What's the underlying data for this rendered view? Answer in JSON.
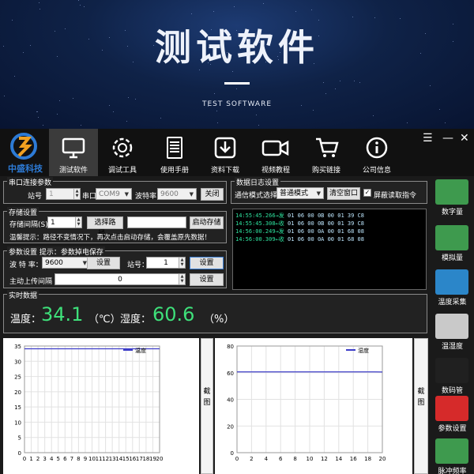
{
  "hero": {
    "title": "测试软件",
    "subtitle": "TEST SOFTWARE"
  },
  "logo": {
    "text": "中盛科技"
  },
  "toolbar": {
    "items": [
      {
        "label": "测试软件",
        "icon": "monitor-icon"
      },
      {
        "label": "调试工具",
        "icon": "gear-icon"
      },
      {
        "label": "使用手册",
        "icon": "document-icon"
      },
      {
        "label": "资料下载",
        "icon": "download-icon"
      },
      {
        "label": "视频教程",
        "icon": "video-camera-icon"
      },
      {
        "label": "购买链接",
        "icon": "shopping-cart-icon"
      },
      {
        "label": "公司信息",
        "icon": "info-icon"
      }
    ]
  },
  "window": {
    "menu": "☰",
    "minimize": "—",
    "close": "✕"
  },
  "serial": {
    "title": "串口连接参数",
    "station_label": "站号",
    "station_value": "1",
    "port_label": "串口",
    "port_value": "COM9",
    "baud_label": "波特率",
    "baud_value": "9600",
    "close_button": "关闭"
  },
  "storage": {
    "title": "存储设置",
    "interval_label": "存储间隔(S)",
    "interval_value": "1",
    "choose_path_button": "选择路径...",
    "path_value": "",
    "start_button": "启动存储",
    "hint": "温馨提示：路径不变情况下，再次点击启动存储，会覆盖原先数据！"
  },
  "params": {
    "title": "参数设置 提示：参数掉电保存",
    "baud_label": "波 特 率：",
    "baud_value": "9600",
    "baud_set": "设置",
    "station_label": "站号：",
    "station_value": "1",
    "station_set": "设置",
    "upload_label": "主动上传间隔",
    "upload_value": "0",
    "upload_set": "设置"
  },
  "logsettings": {
    "title": "数据日志设置",
    "mode_label": "通信模式选择",
    "mode_value": "普通模式",
    "clear_button": "清空窗口",
    "shield_label": "屏蔽读取指令",
    "shield_checked": true
  },
  "log": {
    "lines": [
      {
        "time": "14:55:45.266→发",
        "data": "01 06 00 0B 00 01 39 C8"
      },
      {
        "time": "14:55:45.308←收",
        "data": "01 06 00 0B 00 01 39 C8"
      },
      {
        "time": "14:56:00.249→发",
        "data": "01 06 00 0A 00 01 68 08"
      },
      {
        "time": "14:56:00.309←收",
        "data": "01 06 00 0A 00 01 68 08"
      }
    ]
  },
  "realtime": {
    "title": "实时数据",
    "temp_label": "温度：",
    "temp_value": "34.1",
    "temp_unit": "（℃）",
    "hum_label": "湿度：",
    "hum_value": "60.6",
    "hum_unit": "（%）"
  },
  "shot_button": {
    "label1": "截",
    "label2": "图"
  },
  "chart_data": [
    {
      "type": "line",
      "series": [
        {
          "name": "温度",
          "x": [
            0,
            1,
            2,
            3,
            4,
            5,
            6,
            7,
            8,
            9,
            10,
            11,
            12,
            13,
            14,
            15,
            16,
            17,
            18,
            19,
            20
          ],
          "values": [
            34.1,
            34.1,
            34.1,
            34.1,
            34.1,
            34.1,
            34.1,
            34.1,
            34.1,
            34.1,
            34.1,
            34.1,
            34.1,
            34.1,
            34.1,
            34.1,
            34.1,
            34.1,
            34.1,
            34.1,
            34.1
          ]
        }
      ],
      "xlim": [
        0,
        20
      ],
      "ylim": [
        0,
        35
      ],
      "xticks": [
        0,
        1,
        2,
        3,
        4,
        5,
        6,
        7,
        8,
        9,
        10,
        11,
        12,
        13,
        14,
        15,
        16,
        17,
        18,
        19,
        20
      ],
      "yticks": [
        0,
        5,
        10,
        15,
        20,
        25,
        30,
        35
      ],
      "grid": true,
      "legend": "top-right",
      "color": "#3c3cc8"
    },
    {
      "type": "line",
      "series": [
        {
          "name": "湿度",
          "x": [
            0,
            1,
            2,
            3,
            4,
            5,
            6,
            7,
            8,
            9,
            10,
            11,
            12,
            13,
            14,
            15,
            16,
            17,
            18,
            19,
            20
          ],
          "values": [
            60.6,
            60.6,
            60.6,
            60.6,
            60.6,
            60.6,
            60.6,
            60.6,
            60.6,
            60.6,
            60.6,
            60.6,
            60.6,
            60.6,
            60.6,
            60.6,
            60.6,
            60.6,
            60.6,
            60.6,
            60.5
          ]
        }
      ],
      "xlim": [
        0,
        20
      ],
      "ylim": [
        0,
        80
      ],
      "xticks": [
        0,
        2,
        4,
        6,
        8,
        10,
        12,
        14,
        16,
        18,
        20
      ],
      "yticks": [
        0,
        20,
        40,
        60,
        80
      ],
      "grid": true,
      "legend": "top-right",
      "color": "#3c3cc8"
    }
  ],
  "sidebar": {
    "items": [
      {
        "label": "数字量",
        "icon": "digital-module-icon",
        "color": "#3e9a4e"
      },
      {
        "label": "模拟量",
        "icon": "analog-module-icon",
        "color": "#3e9a4e"
      },
      {
        "label": "温度采集",
        "icon": "temperature-module-icon",
        "color": "#2b86c9"
      },
      {
        "label": "温湿度",
        "icon": "humidity-sensor-icon",
        "color": "#c9c9c9"
      },
      {
        "label": "数码管",
        "icon": "digital-tube-icon",
        "color": "#202020"
      },
      {
        "label": "参数设置",
        "icon": "reset-button-icon",
        "color": "#d62a2a"
      },
      {
        "label": "脉冲频率",
        "icon": "pulse-module-icon",
        "color": "#3e9a4e"
      }
    ]
  }
}
